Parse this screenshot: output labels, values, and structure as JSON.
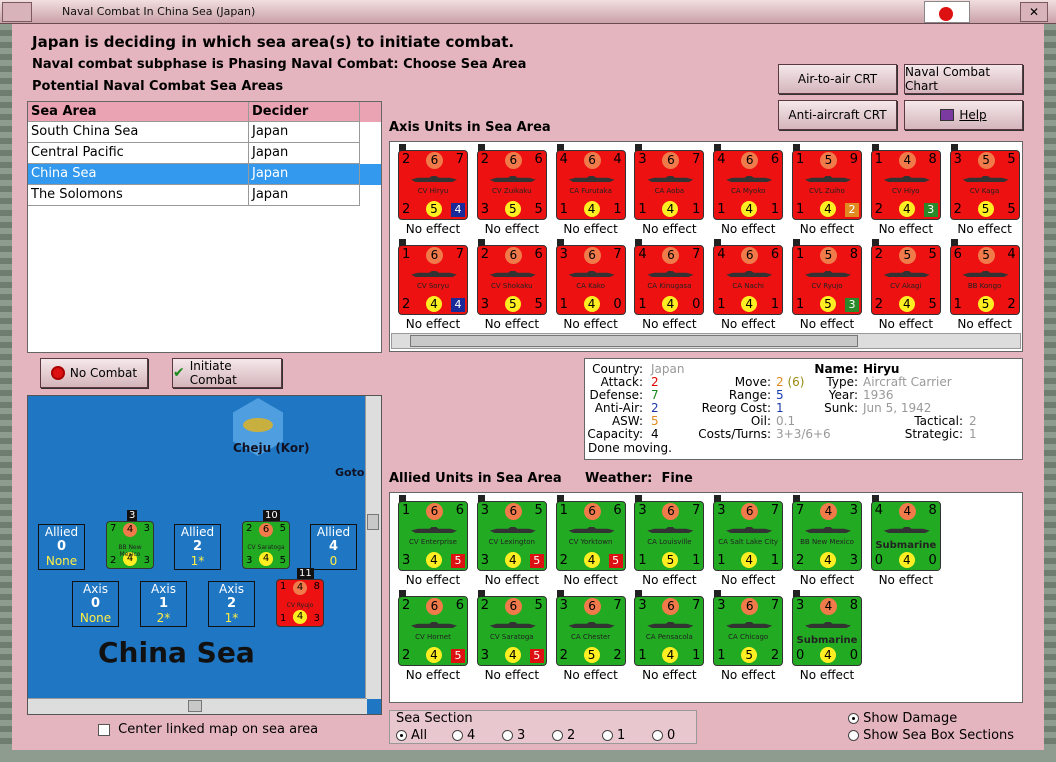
{
  "window": {
    "title": "Naval Combat In China Sea (Japan)"
  },
  "header": {
    "line1": "Japan is deciding in which sea area(s) to initiate combat.",
    "line2": "Naval combat subphase is Phasing Naval Combat: Choose Sea Area",
    "line3": "Potential Naval Combat Sea Areas"
  },
  "buttons": {
    "air_to_air": "Air-to-air CRT",
    "naval_chart": "Naval Combat Chart",
    "anti_aircraft": "Anti-aircraft CRT",
    "help": "Help",
    "no_combat": "No Combat",
    "initiate": "Initiate Combat"
  },
  "sea_table": {
    "headers": [
      "Sea Area",
      "Decider"
    ],
    "rows": [
      [
        "South China Sea",
        "Japan"
      ],
      [
        "Central Pacific",
        "Japan"
      ],
      [
        "China Sea",
        "Japan"
      ],
      [
        "The Solomons",
        "Japan"
      ]
    ],
    "selected_index": 2
  },
  "axis": {
    "label": "Axis Units in Sea Area",
    "effect": "No effect",
    "units": [
      {
        "tl": "2",
        "tc": "6",
        "tr": "7",
        "name": "CV Hiryu",
        "bl": "2",
        "bc": "5",
        "br": "4",
        "boxc": "#1a2a99"
      },
      {
        "tl": "2",
        "tc": "6",
        "tr": "6",
        "name": "CV Zuikaku",
        "bl": "3",
        "bc": "5",
        "br": "5"
      },
      {
        "tl": "4",
        "tc": "6",
        "tr": "4",
        "name": "CA Furutaka",
        "bl": "1",
        "bc": "4",
        "br": "1"
      },
      {
        "tl": "3",
        "tc": "6",
        "tr": "7",
        "name": "CA Aoba",
        "bl": "1",
        "bc": "4",
        "br": "1"
      },
      {
        "tl": "4",
        "tc": "6",
        "tr": "6",
        "name": "CA Myoko",
        "bl": "1",
        "bc": "4",
        "br": "1"
      },
      {
        "tl": "1",
        "tc": "5",
        "tr": "9",
        "name": "CVL Zuiho",
        "bl": "1",
        "bc": "4",
        "br": "2",
        "boxc": "#e08a20"
      },
      {
        "tl": "1",
        "tc": "4",
        "tr": "8",
        "name": "CV Hiyo",
        "bl": "2",
        "bc": "4",
        "br": "3",
        "boxc": "#2a8a2a"
      },
      {
        "tl": "3",
        "tc": "5",
        "tr": "5",
        "name": "CV Kaga",
        "bl": "2",
        "bc": "5",
        "br": "5"
      },
      {
        "tl": "1",
        "tc": "6",
        "tr": "7",
        "name": "CV Soryu",
        "bl": "2",
        "bc": "4",
        "br": "4",
        "boxc": "#1a2a99"
      },
      {
        "tl": "2",
        "tc": "6",
        "tr": "6",
        "name": "CV Shokaku",
        "bl": "3",
        "bc": "5",
        "br": "5"
      },
      {
        "tl": "3",
        "tc": "6",
        "tr": "7",
        "name": "CA Kako",
        "bl": "1",
        "bc": "4",
        "br": "0"
      },
      {
        "tl": "4",
        "tc": "6",
        "tr": "7",
        "name": "CA Kinugasa",
        "bl": "1",
        "bc": "4",
        "br": "0"
      },
      {
        "tl": "4",
        "tc": "6",
        "tr": "6",
        "name": "CA Nachi",
        "bl": "1",
        "bc": "4",
        "br": "1"
      },
      {
        "tl": "1",
        "tc": "5",
        "tr": "8",
        "name": "CV Ryujo",
        "bl": "1",
        "bc": "5",
        "br": "3",
        "boxc": "#2a8a2a"
      },
      {
        "tl": "2",
        "tc": "5",
        "tr": "5",
        "name": "CV Akagi",
        "bl": "2",
        "bc": "4",
        "br": "5"
      },
      {
        "tl": "6",
        "tc": "5",
        "tr": "4",
        "name": "BB Kongo",
        "bl": "1",
        "bc": "5",
        "br": "2"
      }
    ]
  },
  "info": {
    "country": "Japan",
    "attack": "2",
    "defense": "7",
    "anti_air": "2",
    "asw": "5",
    "capacity": "4",
    "status": "Done moving.",
    "move_a": "2",
    "move_b": "(6)",
    "range": "5",
    "reorg_cost": "1",
    "oil": "0.1",
    "costs_turns": "3+3/6+6",
    "name": "Hiryu",
    "type": "Aircraft Carrier",
    "year": "1936",
    "sunk": "Jun 5, 1942",
    "tactical": "2",
    "strategic": "1",
    "labels": {
      "country": "Country:",
      "attack": "Attack:",
      "defense": "Defense:",
      "anti_air": "Anti-Air:",
      "asw": "ASW:",
      "capacity": "Capacity:",
      "move": "Move:",
      "range": "Range:",
      "reorg": "Reorg Cost:",
      "oil": "Oil:",
      "costs": "Costs/Turns:",
      "name": "Name:",
      "type": "Type:",
      "year": "Year:",
      "sunk": "Sunk:",
      "tactical": "Tactical:",
      "strategic": "Strategic:"
    }
  },
  "allied": {
    "label": "Allied Units in Sea Area",
    "weather_label": "Weather:",
    "weather": "Fine",
    "effect": "No effect",
    "units": [
      {
        "tl": "1",
        "tc": "6",
        "tr": "6",
        "name": "CV Enterprise",
        "bl": "3",
        "bc": "4",
        "br": "5",
        "boxc": "#dd1111"
      },
      {
        "tl": "3",
        "tc": "6",
        "tr": "5",
        "name": "CV Lexington",
        "bl": "3",
        "bc": "4",
        "br": "5",
        "boxc": "#dd1111"
      },
      {
        "tl": "1",
        "tc": "6",
        "tr": "6",
        "name": "CV Yorktown",
        "bl": "2",
        "bc": "4",
        "br": "5",
        "boxc": "#dd1111"
      },
      {
        "tl": "3",
        "tc": "6",
        "tr": "7",
        "name": "CA Louisville",
        "bl": "1",
        "bc": "5",
        "br": "1"
      },
      {
        "tl": "3",
        "tc": "6",
        "tr": "7",
        "name": "CA Salt Lake City",
        "bl": "1",
        "bc": "4",
        "br": "1"
      },
      {
        "tl": "7",
        "tc": "4",
        "tr": "3",
        "name": "BB New Mexico",
        "bl": "2",
        "bc": "4",
        "br": "3"
      },
      {
        "tl": "4",
        "tc": "4",
        "tr": "8",
        "name": "Submarine",
        "bl": "0",
        "bc": "4",
        "br": "0",
        "big": true
      },
      {
        "tl": "2",
        "tc": "6",
        "tr": "6",
        "name": "CV Hornet",
        "bl": "2",
        "bc": "4",
        "br": "5",
        "boxc": "#dd1111"
      },
      {
        "tl": "2",
        "tc": "6",
        "tr": "5",
        "name": "CV Saratoga",
        "bl": "3",
        "bc": "4",
        "br": "5",
        "boxc": "#dd1111"
      },
      {
        "tl": "3",
        "tc": "6",
        "tr": "7",
        "name": "CA Chester",
        "bl": "2",
        "bc": "5",
        "br": "2"
      },
      {
        "tl": "3",
        "tc": "6",
        "tr": "7",
        "name": "CA Pensacola",
        "bl": "1",
        "bc": "4",
        "br": "1"
      },
      {
        "tl": "3",
        "tc": "6",
        "tr": "7",
        "name": "CA Chicago",
        "bl": "1",
        "bc": "5",
        "br": "2"
      },
      {
        "tl": "3",
        "tc": "4",
        "tr": "8",
        "name": "Submarine",
        "bl": "0",
        "bc": "4",
        "br": "0",
        "big": true
      }
    ]
  },
  "map": {
    "hex_label": "Cheju (Kor)",
    "goto_label": "Goto",
    "sea_name": "China Sea",
    "allied_boxes": [
      {
        "t": "Allied",
        "n": "0",
        "s": "None"
      },
      {
        "t": "Allied",
        "n": "2",
        "s": "1*"
      },
      {
        "t": "Allied",
        "n": "4",
        "s": "0"
      }
    ],
    "axis_boxes": [
      {
        "t": "Axis",
        "n": "0",
        "s": "None"
      },
      {
        "t": "Axis",
        "n": "1",
        "s": "2*"
      },
      {
        "t": "Axis",
        "n": "2",
        "s": "1*"
      }
    ],
    "stacks": [
      {
        "count": "3",
        "tl": "7",
        "tc": "4",
        "tr": "3",
        "name": "BB New Mexico",
        "bl": "2",
        "bc": "4",
        "br": "3"
      },
      {
        "count": "10",
        "tl": "2",
        "tc": "6",
        "tr": "5",
        "name": "CV Saratoga",
        "bl": "3",
        "bc": "4",
        "br": "5"
      },
      {
        "count": "11",
        "tl": "1",
        "tc": "4",
        "tr": "8",
        "name": "CV Ryujo",
        "bl": "1",
        "bc": "4",
        "br": "3"
      }
    ],
    "center_label": "Center linked map on sea area"
  },
  "sea_section": {
    "label": "Sea Section",
    "options": [
      "All",
      "4",
      "3",
      "2",
      "1",
      "0"
    ],
    "selected": "All"
  },
  "display": {
    "show_damage": "Show Damage",
    "show_sections": "Show Sea Box Sections"
  }
}
